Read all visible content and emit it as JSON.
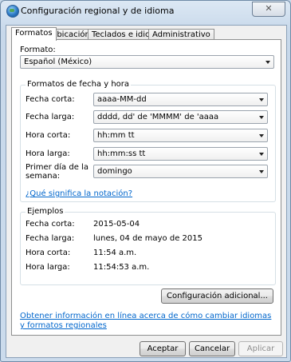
{
  "window": {
    "title": "Configuración regional y de idioma",
    "close_glyph": "✕"
  },
  "tabs": [
    "Formatos",
    "Ubicación",
    "Teclados e idiomas",
    "Administrativo"
  ],
  "formato": {
    "label": "Formato:",
    "value": "Español (México)"
  },
  "date_time_group": {
    "title": "Formatos de fecha y hora",
    "rows": [
      {
        "label": "Fecha corta:",
        "value": "aaaa-MM-dd"
      },
      {
        "label": "Fecha larga:",
        "value": "dddd, dd' de 'MMMM' de 'aaaa"
      },
      {
        "label": "Hora corta:",
        "value": "hh:mm tt"
      },
      {
        "label": "Hora larga:",
        "value": "hh:mm:ss tt"
      },
      {
        "label": "Primer día de la semana:",
        "value": "domingo"
      }
    ],
    "notation_link": "¿Qué significa la notación?"
  },
  "examples": {
    "title": "Ejemplos",
    "rows": [
      {
        "label": "Fecha corta:",
        "value": "2015-05-04"
      },
      {
        "label": "Fecha larga:",
        "value": "lunes, 04 de mayo de 2015"
      },
      {
        "label": "Hora corta:",
        "value": "11:54 a.m."
      },
      {
        "label": "Hora larga:",
        "value": "11:54:53 a.m."
      }
    ]
  },
  "additional_button": "Configuración adicional...",
  "online_link": "Obtener información en línea acerca de cómo cambiar idiomas y formatos regionales",
  "buttons": {
    "accept": "Aceptar",
    "cancel": "Cancelar",
    "apply": "Aplicar"
  }
}
